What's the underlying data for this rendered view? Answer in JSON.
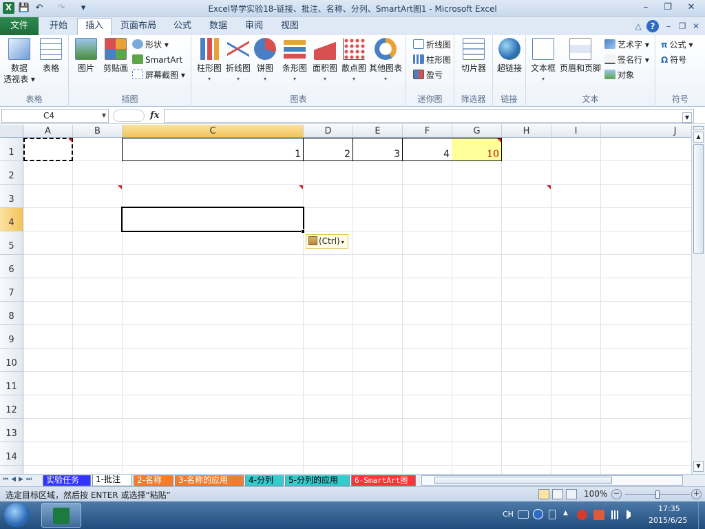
{
  "window": {
    "title": "Excel导学实验18-链接、批注、名称、分列、SmartArt图1 - Microsoft Excel",
    "logo_letter": "X",
    "qat": {
      "save": "💾",
      "undo": "↶",
      "redo": "↷",
      "customize": "▾"
    },
    "controls": {
      "minimize": "–",
      "restore": "❐",
      "close": "✕"
    }
  },
  "ribbon_tabs": {
    "file": "文件",
    "tabs": [
      "开始",
      "插入",
      "页面布局",
      "公式",
      "数据",
      "审阅",
      "视图"
    ],
    "active": "插入",
    "controls": {
      "collapse": "△",
      "help": "?",
      "minimize": "–",
      "restore": "❐",
      "close": "✕"
    }
  },
  "ribbon": {
    "groups": {
      "tables": "表格",
      "illustrations": "插图",
      "charts": "图表",
      "sparklines": "迷你图",
      "filter": "筛选器",
      "links": "链接",
      "text": "文本",
      "symbols": "符号"
    },
    "pivot": {
      "line1": "数据",
      "line2": "透视表 ▾"
    },
    "table": "表格",
    "picture": "图片",
    "clipart": "剪贴画",
    "shapes": "形状 ▾",
    "smartart": "SmartArt",
    "screenshot": "屏幕截图 ▾",
    "charts": [
      "柱形图",
      "折线图",
      "饼图",
      "条形图",
      "面积图",
      "散点图",
      "其他图表"
    ],
    "sparklines": [
      "折线图",
      "柱形图",
      "盈亏"
    ],
    "slicer": "切片器",
    "hyperlink": "超链接",
    "textbox": "文本框",
    "header_footer": "页眉和页脚",
    "wordart": "艺术字 ▾",
    "signature": "签名行 ▾",
    "object": "对象",
    "equation": "公式 ▾",
    "symbol": "符号",
    "equation_icon": "π",
    "symbol_icon": "Ω"
  },
  "formula_bar": {
    "name_box": "C4",
    "fx": "fx",
    "content": ""
  },
  "grid": {
    "columns": [
      "A",
      "B",
      "C",
      "D",
      "E",
      "F",
      "G",
      "H",
      "I",
      "J"
    ],
    "rows": [
      "1",
      "2",
      "3",
      "4",
      "5",
      "6",
      "7",
      "8",
      "9",
      "10",
      "11",
      "12",
      "13",
      "14"
    ],
    "selected_column": "C",
    "selected_row": "4",
    "cells": {
      "C1": "1",
      "D1": "2",
      "E1": "3",
      "F1": "4",
      "G1": "10"
    },
    "paste_options": "(Ctrl)",
    "colors": {
      "highlight_g1": "#ffff99",
      "g1_text": "#c00000",
      "comment_marker": "#d6202a"
    }
  },
  "sheets": [
    "实验任务",
    "1-批注",
    "2-名称",
    "3-名称的应用",
    "4-分列",
    "5-分列的应用",
    "6-SmartArt图"
  ],
  "sheet_nav": [
    "⏮",
    "◀",
    "▶",
    "⏭"
  ],
  "status": {
    "message": "选定目标区域，然后按 ENTER 或选择“粘贴”",
    "zoom": "100%",
    "zoom_level": 1.0,
    "zoom_minus": "－",
    "zoom_plus": "＋"
  },
  "taskbar": {
    "lang": "CH",
    "time": "17:35",
    "date": "2015/6/25"
  }
}
